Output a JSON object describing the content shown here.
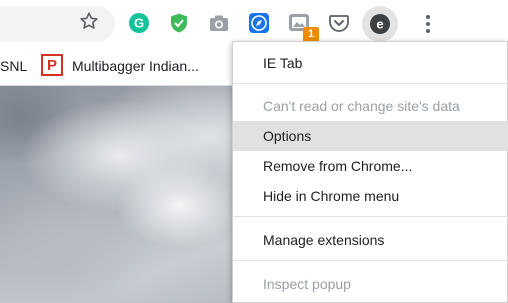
{
  "bookmarks": {
    "items": [
      {
        "label": "SNL"
      },
      {
        "label": "Multibagger Indian..."
      }
    ]
  },
  "extensions": {
    "grammarly_icon": "grammarly-icon",
    "badge_count": "1"
  },
  "menu": {
    "items": [
      {
        "label": "IE Tab",
        "disabled": false
      },
      {
        "label": "Can't read or change site's data",
        "disabled": true
      },
      {
        "label": "Options",
        "disabled": false,
        "highlighted": true
      },
      {
        "label": "Remove from Chrome...",
        "disabled": false
      },
      {
        "label": "Hide in Chrome menu",
        "disabled": false
      },
      {
        "label": "Manage extensions",
        "disabled": false
      },
      {
        "label": "Inspect popup",
        "disabled": true
      }
    ]
  },
  "colors": {
    "highlight": "#e1e1e1",
    "disabled_text": "#9aa0a6",
    "badge": "#f28b00"
  }
}
